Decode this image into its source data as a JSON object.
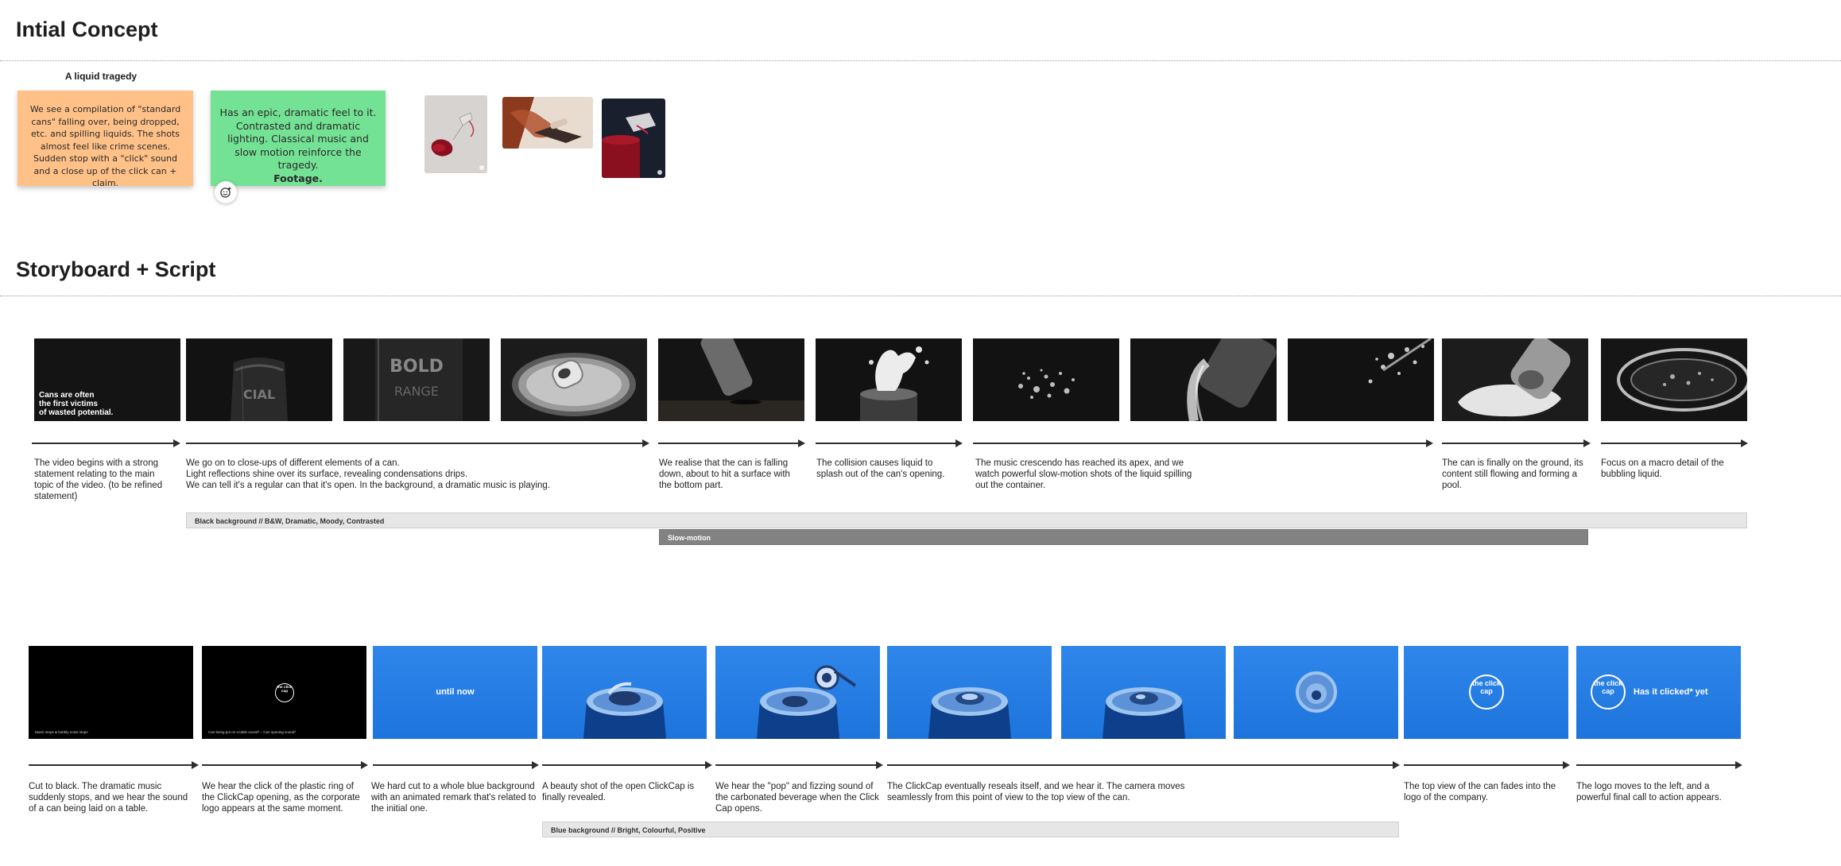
{
  "concept": {
    "title": "Intial Concept",
    "sticky_title": "A liquid tragedy",
    "orange_note": "We see a compilation of \"standard cans\" falling over, being dropped, etc. and spilling liquids. The shots almost feel like crime scenes. Sudden stop with a \"click\" sound and a close up of the click can + claim.",
    "green_note": "Has an epic, dramatic feel to it. Contrasted and dramatic lighting. Classical music and slow motion reinforce the tragedy.",
    "green_note_strong": "Footage.",
    "react_icon": "add-reaction-icon"
  },
  "storyboard": {
    "title": "Storyboard + Script",
    "row1": {
      "frame1_text": "Cans are often\nthe first victims\nof wasted potential.",
      "descriptions": [
        "The video begins with a strong statement relating to the main topic of the video. (to be refined statement)",
        "We go on to close-ups of different elements of a can.\nLight reflections shine over its surface, revealing condensations drips.\nWe can tell it's a regular can that it's open. In the background, a dramatic music is playing.",
        "We realise that the can is falling down, about to hit a surface with the bottom part.",
        "The collision causes liquid to splash out of the can's opening.",
        "The music crescendo has reached its apex, and we watch powerful slow-motion shots of the liquid spilling out the container.",
        "The can is finally on the ground, its content still flowing and forming a pool.",
        "Focus on a macro detail of the bubbling liquid."
      ],
      "band_mood": "Black background // B&W, Dramatic, Moody, Contrasted",
      "band_slowmo": "Slow-motion"
    },
    "row2": {
      "frame1_caption": "Music stops & bubbly noise stops",
      "frame2_caption": "Can being put on a table sound* – Can opening sound*",
      "logo_text": "the click cap",
      "until_now": "until now",
      "cta": "Has it clicked* yet",
      "descriptions": [
        "Cut to black. The dramatic music suddenly stops, and we hear the sound of a can being laid on a table.",
        "We hear the click of the plastic ring of the ClickCap opening, as the corporate logo appears at the same moment.",
        "We hard cut to a whole blue background with an animated remark that's related to the initial one.",
        "A beauty shot of the open ClickCap is finally revealed.",
        "We hear the \"pop\" and fizzing sound of the carbonated beverage when the Click Cap opens.",
        "The ClickCap eventually reseals itself, and we hear it. The camera moves seamlessly from this point of view to the top view of the can.",
        "The top view of the can fades into the logo of the company.",
        "The logo moves to the left, and a powerful final call to action appears."
      ],
      "band_mood": "Blue background // Bright, Colourful, Positive"
    }
  },
  "colors": {
    "orange_sticky": "#ffc187",
    "green_sticky": "#74e294",
    "brand_blue": "#1f78e0",
    "frame_dark": "#141414"
  }
}
